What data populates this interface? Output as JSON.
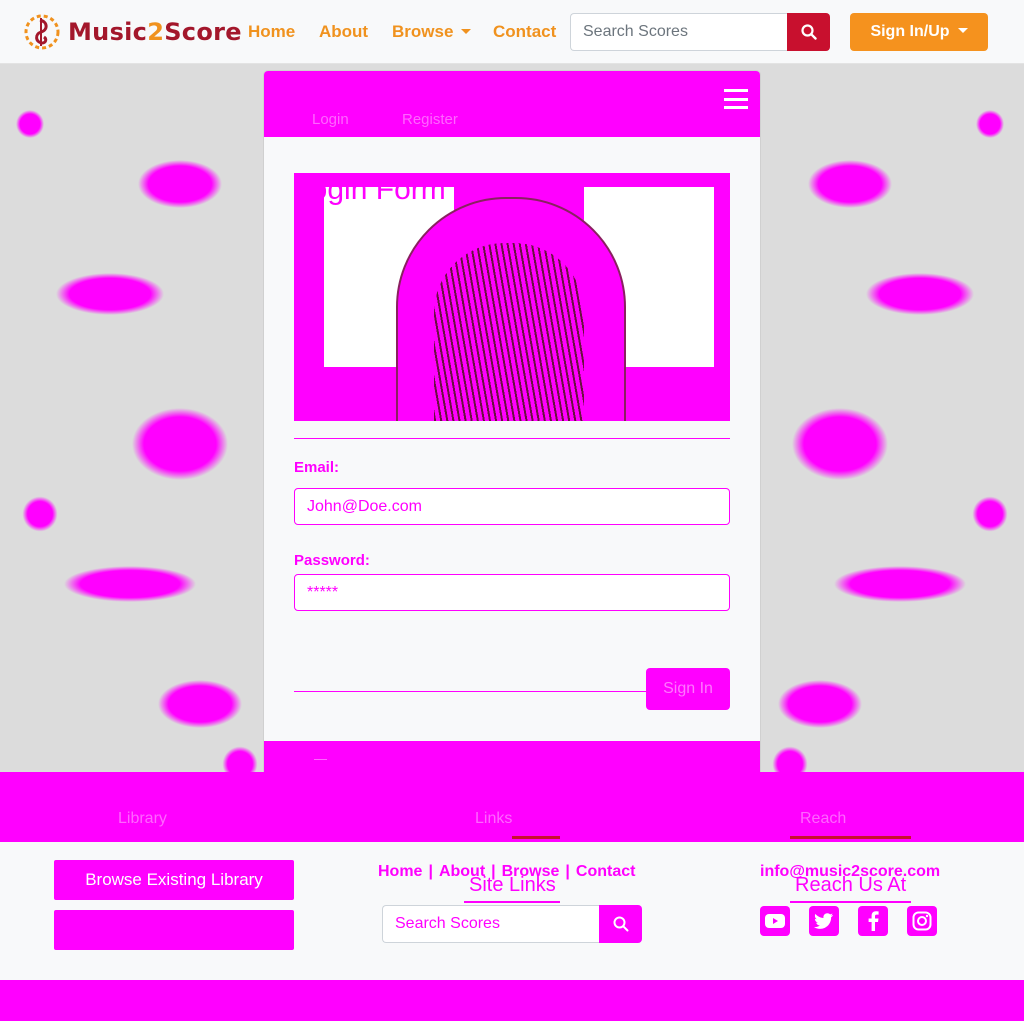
{
  "brand": {
    "name_a": "Music",
    "name_b": "2",
    "name_c": "Score"
  },
  "nav": {
    "home": "Home",
    "about": "About",
    "browse": "Browse",
    "contact": "Contact"
  },
  "search": {
    "placeholder": "Search Scores"
  },
  "auth": {
    "signin_label": "Sign In/Up"
  },
  "card": {
    "tabs": [
      "Login",
      "Register"
    ],
    "title": "Login Form",
    "email_label": "Email:",
    "email_value": "John@Doe.com",
    "password_label": "Password:",
    "password_value": "*****",
    "submit_label": "Sign In"
  },
  "footer": {
    "library_button": "Browse Existing Library",
    "links": [
      "Home",
      "About",
      "Browse",
      "Contact"
    ],
    "site_links_heading": "Site Links",
    "search_placeholder": "Search Scores",
    "email": "info@music2score.com",
    "reach_heading": "Reach Us At",
    "social_icons": [
      "youtube-icon",
      "twitter-icon",
      "facebook-icon",
      "instagram-icon"
    ]
  },
  "colors": {
    "brand_red": "#a3172b",
    "brand_orange": "#f0921e",
    "accent_magenta": "#ff00ff"
  }
}
